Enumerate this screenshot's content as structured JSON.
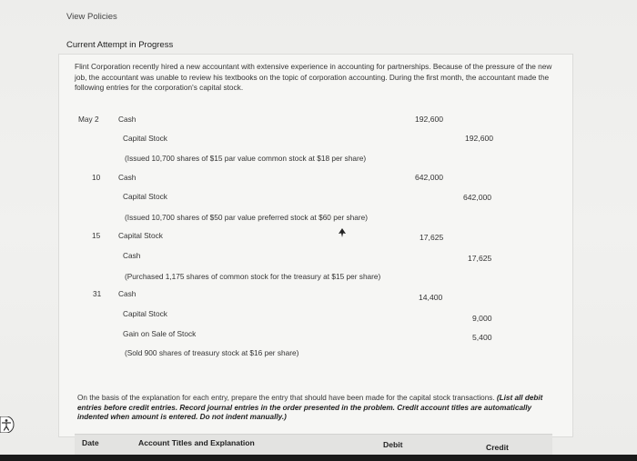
{
  "header": {
    "view_policies": "View Policies",
    "attempt_status": "Current Attempt in Progress"
  },
  "problem": {
    "intro": "Flint Corporation recently hired a new accountant with extensive experience in accounting for partnerships. Because of the pressure of the new job, the accountant was unable to review his textbooks on the topic of corporation accounting. During the first month, the accountant made the following entries for the corporation's capital stock.",
    "entries": [
      {
        "date": "May 2",
        "lines": [
          {
            "account": "Cash",
            "debit": "192,600",
            "credit": ""
          },
          {
            "account": "Capital Stock",
            "debit": "",
            "credit": "192,600"
          }
        ],
        "note": "(Issued 10,700 shares of $15 par value common stock at $18 per share)"
      },
      {
        "date": "10",
        "lines": [
          {
            "account": "Cash",
            "debit": "642,000",
            "credit": ""
          },
          {
            "account": "Capital Stock",
            "debit": "",
            "credit": "642,000"
          }
        ],
        "note": "(Issued 10,700 shares of $50 par value preferred stock at $60 per share)"
      },
      {
        "date": "15",
        "lines": [
          {
            "account": "Capital Stock",
            "debit": "17,625",
            "credit": ""
          },
          {
            "account": "Cash",
            "debit": "",
            "credit": "17,625"
          }
        ],
        "note": "(Purchased 1,175 shares of common stock for the treasury at $15 per share)"
      },
      {
        "date": "31",
        "lines": [
          {
            "account": "Cash",
            "debit": "14,400",
            "credit": ""
          },
          {
            "account": "Capital Stock",
            "debit": "",
            "credit": "9,000"
          },
          {
            "account": "Gain on Sale of Stock",
            "debit": "",
            "credit": "5,400"
          }
        ],
        "note": "(Sold 900 shares of treasury stock at $16 per share)"
      }
    ],
    "instructions_plain": "On the basis of the explanation for each entry, prepare the entry that should have been made for the capital stock transactions.",
    "instructions_emphasis": "(List all debit entries before credit entries. Record journal entries in the order presented in the problem. Credit account titles are automatically indented when amount is entered. Do not indent manually.)"
  },
  "table": {
    "col_date": "Date",
    "col_account": "Account Titles and Explanation",
    "col_debit": "Debit",
    "col_credit": "Credit"
  },
  "icons": {
    "accessibility": "accessibility-icon"
  }
}
